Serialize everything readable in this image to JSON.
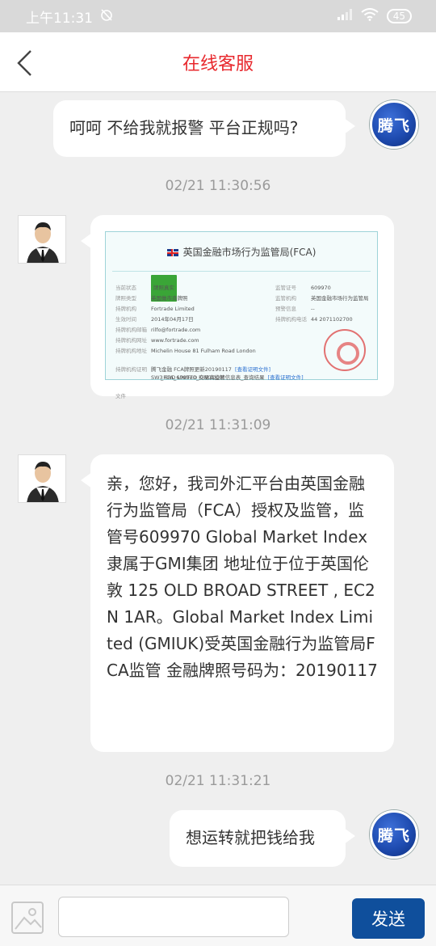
{
  "status": {
    "time": "上午11:31",
    "battery": "45",
    "signal_icon": "signal-icon",
    "wifi_icon": "wifi-icon",
    "dnd_icon": "alarm-off-icon"
  },
  "header": {
    "title": "在线客服",
    "back_icon": "chevron-left-icon"
  },
  "messages": [
    {
      "side": "right",
      "avatar_text": "腾飞",
      "text": "呵呵 不给我就报警 平台正规吗?"
    },
    {
      "timestamp": "02/21 11:30:56"
    },
    {
      "side": "left",
      "type": "image"
    },
    {
      "timestamp": "02/21 11:31:09"
    },
    {
      "side": "left",
      "text": "亲，您好，我司外汇平台由英国金融行为监管局（FCA）授权及监管，监管号609970 Global Market Index隶属于GMI集团 地址位于位于英国伦敦 125 OLD BROAD STREET , EC2N 1AR。Global Market Index Limited (GMIUK)受英国金融行为监管局FCA监管 金融牌照号码为：20190117"
    },
    {
      "timestamp": "02/21 11:31:21"
    },
    {
      "side": "right",
      "avatar_text": "腾飞",
      "text": "想运转就把钱给我"
    }
  ],
  "certificate": {
    "title": "英国金融市场行为监管局(FCA)",
    "rows_left": [
      {
        "k": "当前状态",
        "v": "牌照真实"
      },
      {
        "k": "牌照类型",
        "v": "英国做市商牌照"
      },
      {
        "k": "持牌机构",
        "v": "Fortrade Limited"
      },
      {
        "k": "生效时间",
        "v": "2014年04月17日"
      },
      {
        "k": "持牌机构邮箱",
        "v": "rilfo@fortrade.com"
      },
      {
        "k": "持牌机构网址",
        "v": "www.fortrade.com"
      },
      {
        "k": "持牌机构地址",
        "v": "Michelin House 81 Fulham Road London SW3 6RD UNITED KINGDOM"
      },
      {
        "k": "持牌机构证明文件",
        "v": "腾飞金融 FCA牌照更新20190117"
      }
    ],
    "rows_right": [
      {
        "k": "监管证号",
        "v": "609970"
      },
      {
        "k": "监管机构",
        "v": "英国金融市场行为监管局"
      },
      {
        "k": "预警信息",
        "v": "--"
      },
      {
        "k": "持牌机构电话",
        "v": "44 2071102700"
      }
    ],
    "links": [
      "[查看证明文件]",
      "_FCA_609970_交易商监管信息表_查询结果",
      "[查看证明文件]"
    ]
  },
  "input": {
    "placeholder": "",
    "send_label": "发送",
    "image_icon": "image-icon"
  }
}
